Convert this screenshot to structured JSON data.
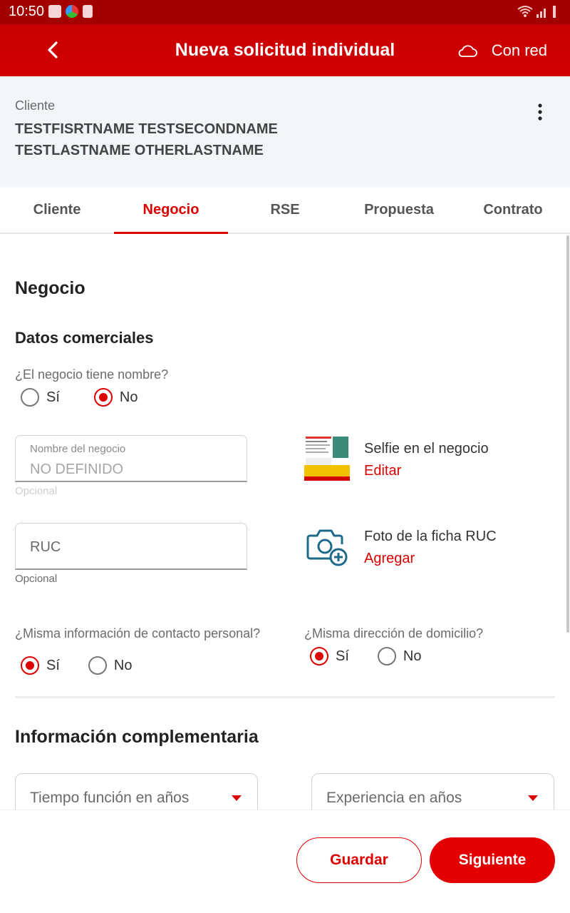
{
  "status_bar": {
    "time": "10:50"
  },
  "header": {
    "title": "Nueva solicitud individual",
    "network_label": "Con red"
  },
  "client": {
    "label": "Cliente",
    "name_line1": "TESTFISRTNAME TESTSECONDNAME",
    "name_line2": "TESTLASTNAME OTHERLASTNAME"
  },
  "tabs": [
    {
      "label": "Cliente"
    },
    {
      "label": "Negocio"
    },
    {
      "label": "RSE"
    },
    {
      "label": "Propuesta"
    },
    {
      "label": "Contrato"
    }
  ],
  "active_tab": "Negocio",
  "section": {
    "title": "Negocio",
    "subtitle": "Datos comerciales",
    "has_name_question": "¿El negocio tiene nombre?",
    "yes_label": "Sí",
    "no_label": "No",
    "has_name_selected": "No",
    "business_name": {
      "label": "Nombre del negocio",
      "value": "NO DEFINIDO",
      "helper": "Opcional"
    },
    "ruc": {
      "placeholder": "RUC",
      "helper": "Opcional"
    },
    "selfie": {
      "title": "Selfie en el negocio",
      "action": "Editar"
    },
    "ruc_photo": {
      "title": "Foto de la ficha RUC",
      "action": "Agregar"
    },
    "same_contact_question": "¿Misma información de contacto personal?",
    "same_contact_selected": "Sí",
    "same_address_question": "¿Misma dirección de domicilio?",
    "same_address_selected": "Sí"
  },
  "complementary": {
    "title": "Información complementaria",
    "years_function_placeholder": "Tiempo función en años",
    "experience_placeholder": "Experiencia en años"
  },
  "footer": {
    "save_label": "Guardar",
    "next_label": "Siguiente"
  },
  "colors": {
    "brand_red": "#dd0000",
    "header_dark": "#a30000",
    "client_bg": "#f1f6f9"
  }
}
